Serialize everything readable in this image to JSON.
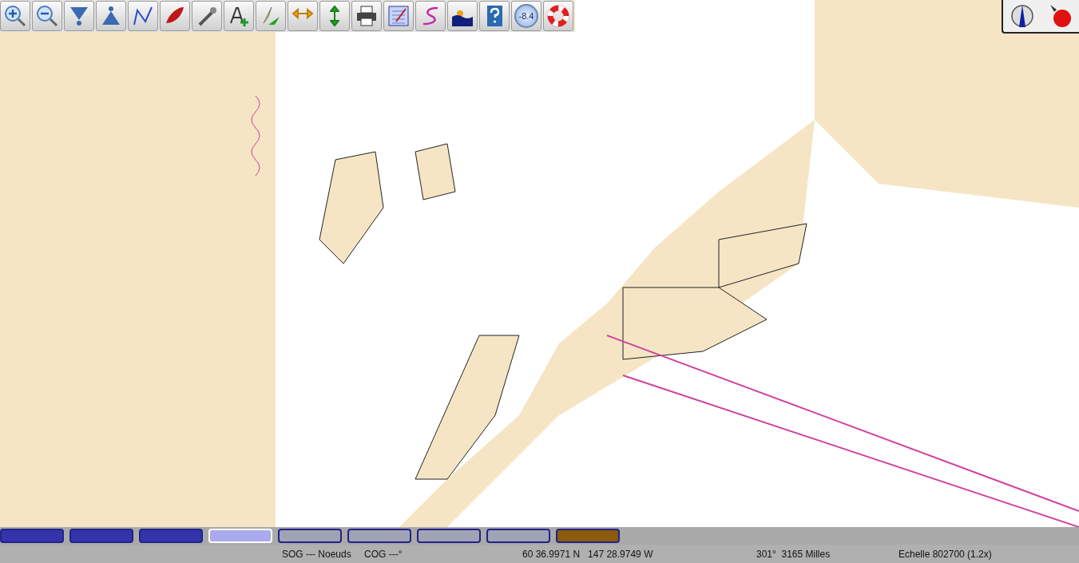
{
  "toolbar": {
    "buttons": [
      {
        "kind": "zoom-in"
      },
      {
        "kind": "zoom-out"
      },
      {
        "kind": "scale-down"
      },
      {
        "kind": "scale-up"
      },
      {
        "kind": "route"
      },
      {
        "kind": "boat"
      },
      {
        "kind": "tools"
      },
      {
        "kind": "text"
      },
      {
        "kind": "mark"
      },
      {
        "kind": "pan-horizontal"
      },
      {
        "kind": "pan-vertical"
      },
      {
        "kind": "print"
      },
      {
        "kind": "list"
      },
      {
        "kind": "track"
      },
      {
        "kind": "tide"
      },
      {
        "kind": "help"
      },
      {
        "kind": "gauge",
        "label": "-8.4"
      },
      {
        "kind": "lifebuoy"
      }
    ]
  },
  "chart": {
    "kind": "nautical-chart"
  },
  "piano": {
    "keys": [
      {
        "color": "#3333aa",
        "selected": false
      },
      {
        "color": "#3333aa",
        "selected": false
      },
      {
        "color": "#3333aa",
        "selected": false
      },
      {
        "color": "#aaaaee",
        "selected": true
      },
      {
        "color": "#9ea4b4",
        "selected": false
      },
      {
        "color": "#9ea4b4",
        "selected": false
      },
      {
        "color": "#9ea4b4",
        "selected": false
      },
      {
        "color": "#9ea4b4",
        "selected": false
      },
      {
        "color": "#8b5a0a",
        "selected": false
      }
    ]
  },
  "status_bar": {
    "sog": "SOG --- Noeuds",
    "cog": "COG ---°",
    "position": "60 36.9971 N   147 28.9749 W",
    "bearing": "301°  3165 Milles",
    "scale": "Echelle 802700 (1.2x)"
  }
}
